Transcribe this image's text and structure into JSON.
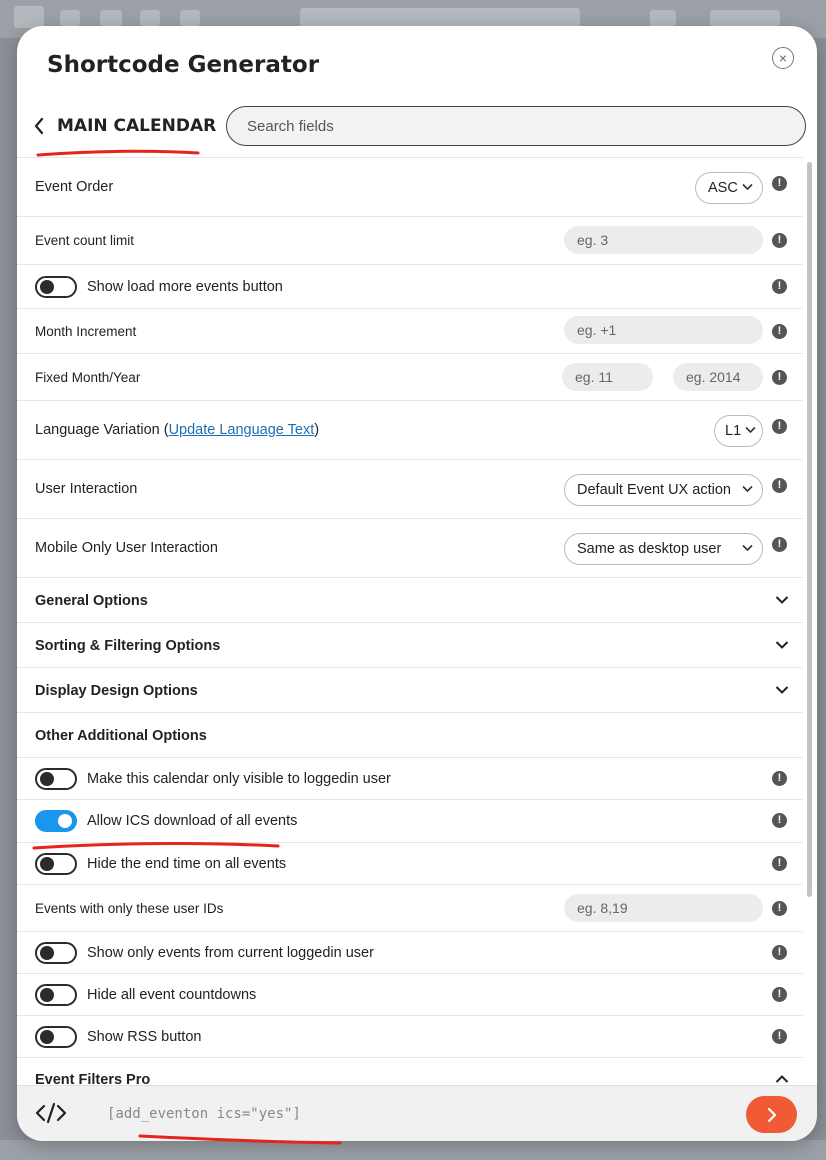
{
  "modal": {
    "title": "Shortcode Generator",
    "close_glyph": "×"
  },
  "header": {
    "calendar_name": "MAIN CALENDAR",
    "search_placeholder": "Search fields"
  },
  "rows": {
    "event_order": {
      "label": "Event Order",
      "value": "ASC"
    },
    "event_count_limit": {
      "label": "Event count limit",
      "placeholder": "eg. 3"
    },
    "show_load_more": {
      "label": "Show load more events button",
      "on": false
    },
    "month_increment": {
      "label": "Month Increment",
      "placeholder": "eg. +1"
    },
    "fixed_month_year": {
      "label": "Fixed Month/Year",
      "month_placeholder": "eg. 11",
      "year_placeholder": "eg. 2014"
    },
    "language_variation": {
      "label": "Language Variation (",
      "link": "Update Language Text",
      "label_end": ")",
      "value": "L1"
    },
    "user_interaction": {
      "label": "User Interaction",
      "value": "Default Event UX action"
    },
    "mobile_interaction": {
      "label": "Mobile Only User Interaction",
      "value": "Same as desktop user"
    }
  },
  "sections": {
    "general": "General Options",
    "sorting": "Sorting & Filtering Options",
    "display": "Display Design Options",
    "other": "Other Additional Options",
    "filters_pro": "Event Filters Pro"
  },
  "other_options": {
    "loggedin_visible": {
      "label": "Make this calendar only visible to loggedin user",
      "on": false
    },
    "ics_download": {
      "label": "Allow ICS download of all events",
      "on": true
    },
    "hide_end_time": {
      "label": "Hide the end time on all events",
      "on": false
    },
    "user_ids": {
      "label": "Events with only these user IDs",
      "placeholder": "eg. 8,19"
    },
    "current_user_events": {
      "label": "Show only events from current loggedin user",
      "on": false
    },
    "hide_countdowns": {
      "label": "Hide all event countdowns",
      "on": false
    },
    "rss_button": {
      "label": "Show RSS button",
      "on": false
    }
  },
  "footer": {
    "shortcode": "[add_eventon ics=\"yes\"]"
  },
  "colors": {
    "accent_toggle": "#1a96ee",
    "submit_button": "#f05a35",
    "annotation": "#e8241a"
  }
}
